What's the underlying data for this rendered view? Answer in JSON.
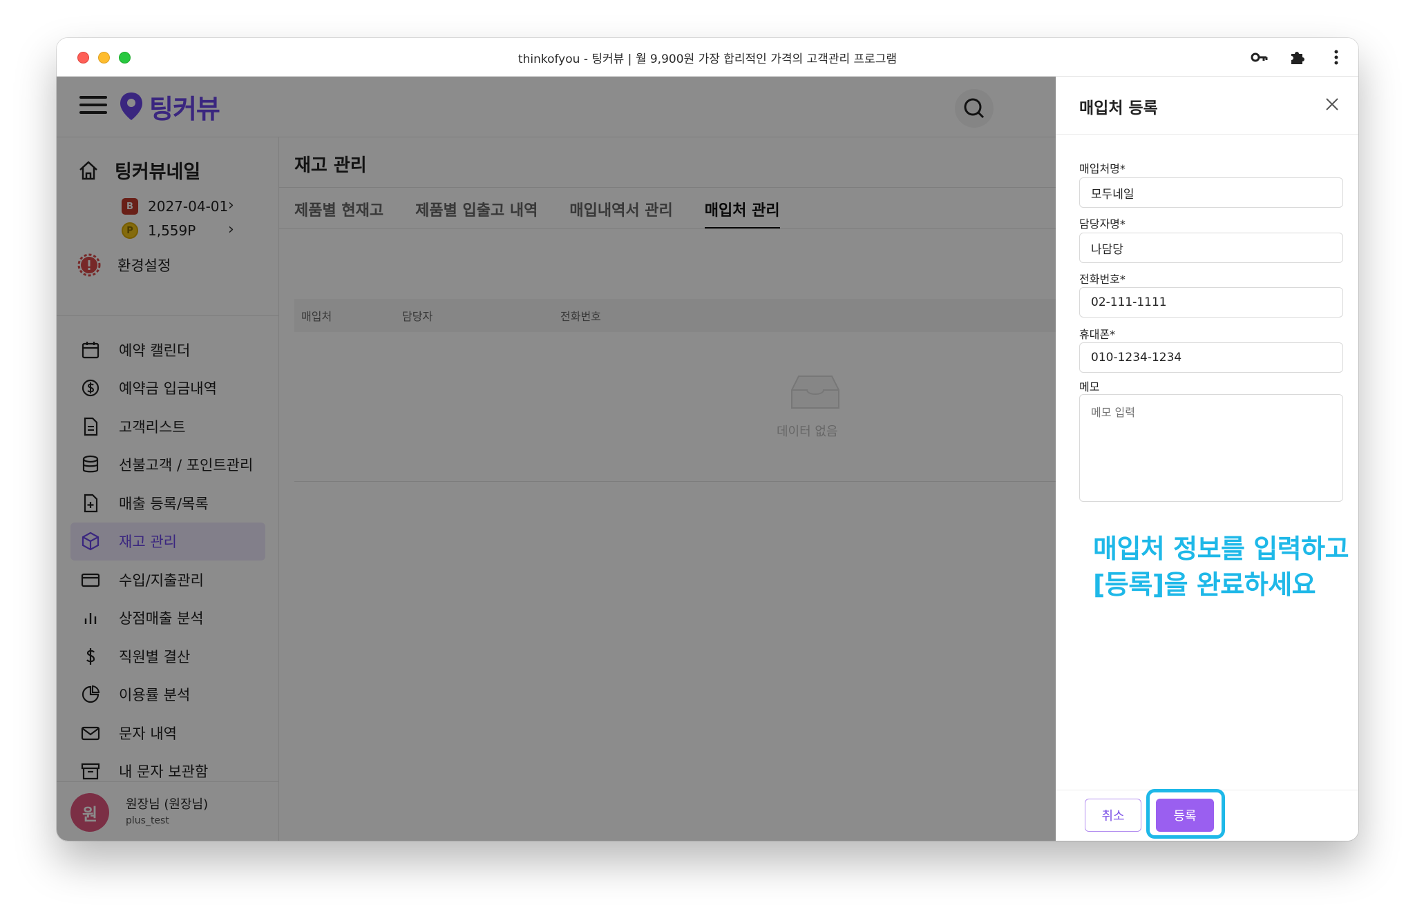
{
  "window": {
    "title": "thinkofyou - 팅커뷰 | 월 9,900원 가장 합리적인 가격의 고객관리 프로그램"
  },
  "header": {
    "logo_text": "팅커뷰"
  },
  "sidebar": {
    "shop_name": "팅커뷰네일",
    "expiry_badge": "B",
    "expiry_date": "2027-04-01",
    "points_badge": "P",
    "points": "1,559P",
    "settings_label": "환경설정",
    "items": [
      {
        "label": "예약 캘린더",
        "icon": "calendar-icon"
      },
      {
        "label": "예약금 입금내역",
        "icon": "dollar-circle-icon"
      },
      {
        "label": "고객리스트",
        "icon": "document-icon"
      },
      {
        "label": "선불고객 / 포인트관리",
        "icon": "database-icon"
      },
      {
        "label": "매출 등록/목록",
        "icon": "file-plus-icon"
      },
      {
        "label": "재고 관리",
        "icon": "box-icon",
        "active": true
      },
      {
        "label": "수입/지출관리",
        "icon": "credit-card-icon"
      },
      {
        "label": "상점매출 분석",
        "icon": "bar-chart-icon"
      },
      {
        "label": "직원별 결산",
        "icon": "dollar-icon"
      },
      {
        "label": "이용률 분석",
        "icon": "pie-chart-icon"
      },
      {
        "label": "문자 내역",
        "icon": "mail-icon"
      },
      {
        "label": "내 문자 보관함",
        "icon": "archive-icon"
      }
    ],
    "user": {
      "avatar_text": "원",
      "name": "원장님 (원장님)",
      "id": "plus_test"
    }
  },
  "main": {
    "title": "재고 관리",
    "tabs": [
      "제품별 현재고",
      "제품별 입출고 내역",
      "매입내역서 관리",
      "매입처 관리"
    ],
    "active_tab": 3,
    "table": {
      "columns": [
        "매입처",
        "담당자",
        "전화번호"
      ],
      "empty_text": "데이터 없음"
    }
  },
  "drawer": {
    "title": "매입처 등록",
    "fields": [
      {
        "label": "매입처명*",
        "value": "모두네일"
      },
      {
        "label": "담당자명*",
        "value": "나담당"
      },
      {
        "label": "전화번호*",
        "value": "02-111-1111"
      },
      {
        "label": "휴대폰*",
        "value": "010-1234-1234"
      }
    ],
    "memo": {
      "label": "메모",
      "placeholder": "메모 입력"
    },
    "hint_line1": "매입처 정보를 입력하고",
    "hint_line2": "[등록]을 완료하세요",
    "cancel_label": "취소",
    "submit_label": "등록"
  },
  "colors": {
    "brand": "#6b46e8",
    "highlight": "#1eb8e8",
    "submit": "#9a5ff0"
  }
}
